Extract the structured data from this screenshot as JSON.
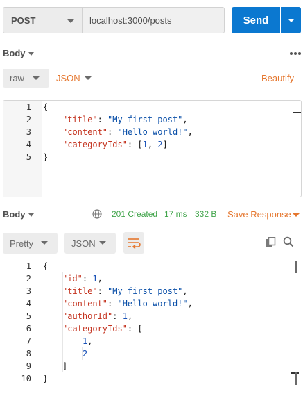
{
  "request": {
    "method": "POST",
    "url": "localhost:3000/posts",
    "send_label": "Send"
  },
  "body_section": {
    "label": "Body",
    "mode": "raw",
    "format": "JSON",
    "beautify_label": "Beautify"
  },
  "request_body": {
    "line_numbers": [
      "1",
      "2",
      "3",
      "4",
      "5"
    ]
  },
  "response": {
    "label": "Body",
    "status": "201 Created",
    "time": "17 ms",
    "size": "332 B",
    "save_label": "Save Response",
    "view_mode": "Pretty",
    "format": "JSON",
    "line_numbers": [
      "1",
      "2",
      "3",
      "4",
      "5",
      "6",
      "7",
      "8",
      "9",
      "10"
    ]
  },
  "colors": {
    "accent": "#e5772f",
    "send": "#0b78d0",
    "status_ok": "#40a44a",
    "json_key": "#c4331f",
    "json_string": "#0a4fa8"
  },
  "icons": [
    "chevron-down-icon",
    "more-dots-icon",
    "globe-icon",
    "wrap-lines-icon",
    "copy-icon",
    "search-icon"
  ]
}
